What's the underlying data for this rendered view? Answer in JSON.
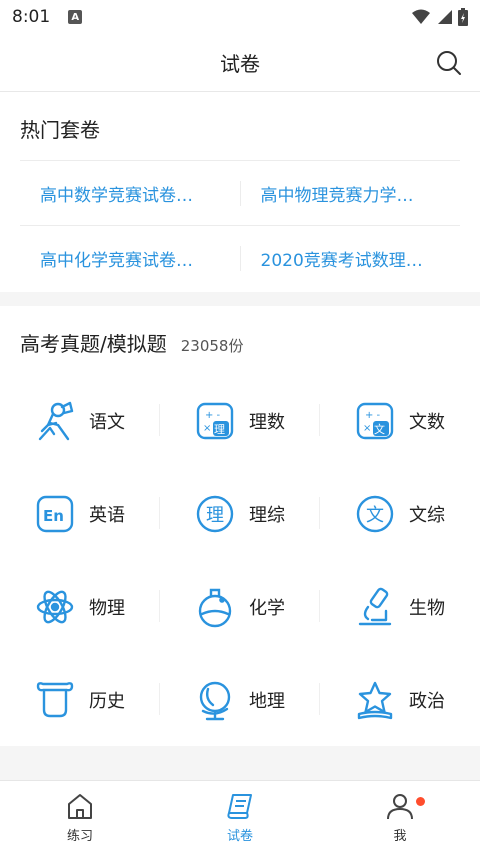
{
  "status": {
    "time": "8:01"
  },
  "header": {
    "title": "试卷"
  },
  "hot": {
    "title": "热门套卷",
    "items": [
      "高中数学竞赛试卷…",
      "高中物理竞赛力学…",
      "高中化学竞赛试卷…",
      "2020竞赛考试数理…"
    ]
  },
  "exams": {
    "title": "高考真题/模拟题",
    "count": "23058份",
    "subjects": [
      {
        "label": "语文",
        "icon": "reader-icon"
      },
      {
        "label": "理数",
        "icon": "calculator-icon"
      },
      {
        "label": "文数",
        "icon": "calculator-icon"
      },
      {
        "label": "英语",
        "icon": "en-icon"
      },
      {
        "label": "理综",
        "icon": "li-circle-icon"
      },
      {
        "label": "文综",
        "icon": "wen-circle-icon"
      },
      {
        "label": "物理",
        "icon": "atom-icon"
      },
      {
        "label": "化学",
        "icon": "flask-icon"
      },
      {
        "label": "生物",
        "icon": "microscope-icon"
      },
      {
        "label": "历史",
        "icon": "column-icon"
      },
      {
        "label": "地理",
        "icon": "globe-icon"
      },
      {
        "label": "政治",
        "icon": "star-icon"
      }
    ]
  },
  "tabs": [
    {
      "label": "练习",
      "icon": "home-icon"
    },
    {
      "label": "试卷",
      "icon": "scroll-icon"
    },
    {
      "label": "我",
      "icon": "user-icon"
    }
  ],
  "colors": {
    "accent": "#2a93de",
    "badge": "#ff4d2d"
  }
}
